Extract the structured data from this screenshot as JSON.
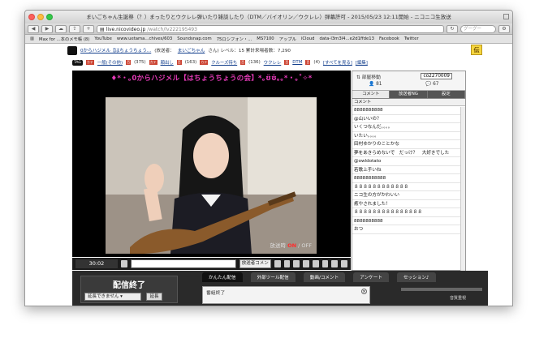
{
  "window": {
    "title": "まいごちゃん生誕祭（？）まったりとウクレレ弾いたり雑談したり（DTM／バイオリン／ウクレレ）弾幕許可 - 2015/05/23 12:11開始 - ニコニコ生放送"
  },
  "toolbar": {
    "url_domain": "live.nicovideo.jp",
    "url_path": "/watch/lv222195493",
    "search_placeholder": "グーグー"
  },
  "bookmarks": [
    "Max for ...本のメモ帳 (8)",
    "YouTube",
    "www.uetama...chives/603",
    "Soundsnap.com",
    "75ロシフォン・...",
    "MS7100",
    "アップル",
    "iCloud",
    "data-l3m3l4...e2d1ffde13",
    "Facebook",
    "Twitter"
  ],
  "niconav": {
    "title_link": "0からハジメル【はちょうちょう...",
    "broadcaster_label": "(放送者：",
    "broadcaster": "まいごちゃん",
    "level": "さん) レベル：15 累計来場者数：7,290",
    "den": "伝"
  },
  "tags": {
    "tag_label": "TAG",
    "items": [
      {
        "label": "一般(その他)",
        "count": "(375)"
      },
      {
        "label": "顔出し",
        "count": "(163)"
      },
      {
        "label": "クルーズ待ち",
        "count": "(136)"
      },
      {
        "label": "ウクレレ",
        "count": ""
      },
      {
        "label": "DTM",
        "count": "(4)"
      }
    ],
    "see_all": "[すべてを見る]",
    "edit": "[編集]"
  },
  "player": {
    "banner": "♦*・｡0からハジメル【はちょうちょうの会】*｡ʊ̈ʊ̈｡｡*・｡˚✧*",
    "on_label": "ON",
    "off_label": "/ OFF",
    "watermark": "放送時"
  },
  "controls": {
    "time": "30:02",
    "comment_button": "放送者コメン"
  },
  "side": {
    "room_move": "部屋移動",
    "community": "co2270009",
    "viewers": "81",
    "comments": "67",
    "tabs": [
      "コメント",
      "放送者NG",
      "設定"
    ],
    "col_header": "コメント",
    "comments_list": [
      "8888888888",
      "@山いいの？",
      "いくつなんだ。。。。",
      "いたい。。。。",
      "田村ゆかりのことかな",
      "夢をあきらめないで　だっけ？　大好きでした",
      "@owldotato",
      "若歌上手いね",
      "88888888888",
      "８８８８８８８８８８８８",
      "ニコ生の方がかわいい",
      "癒やされました！",
      "８８８８８８８８８８８８８８８",
      "8888888888",
      "おつ"
    ]
  },
  "lower": {
    "end_title": "配信終了",
    "extend_select": "延長できません",
    "extend_button": "延長",
    "tabs": [
      "かんたん配信",
      "外部ツール配信",
      "動画/コメント",
      "アンケート",
      "セッション♪"
    ],
    "popup_title": "番組終了",
    "volume_label": "音質重視"
  }
}
